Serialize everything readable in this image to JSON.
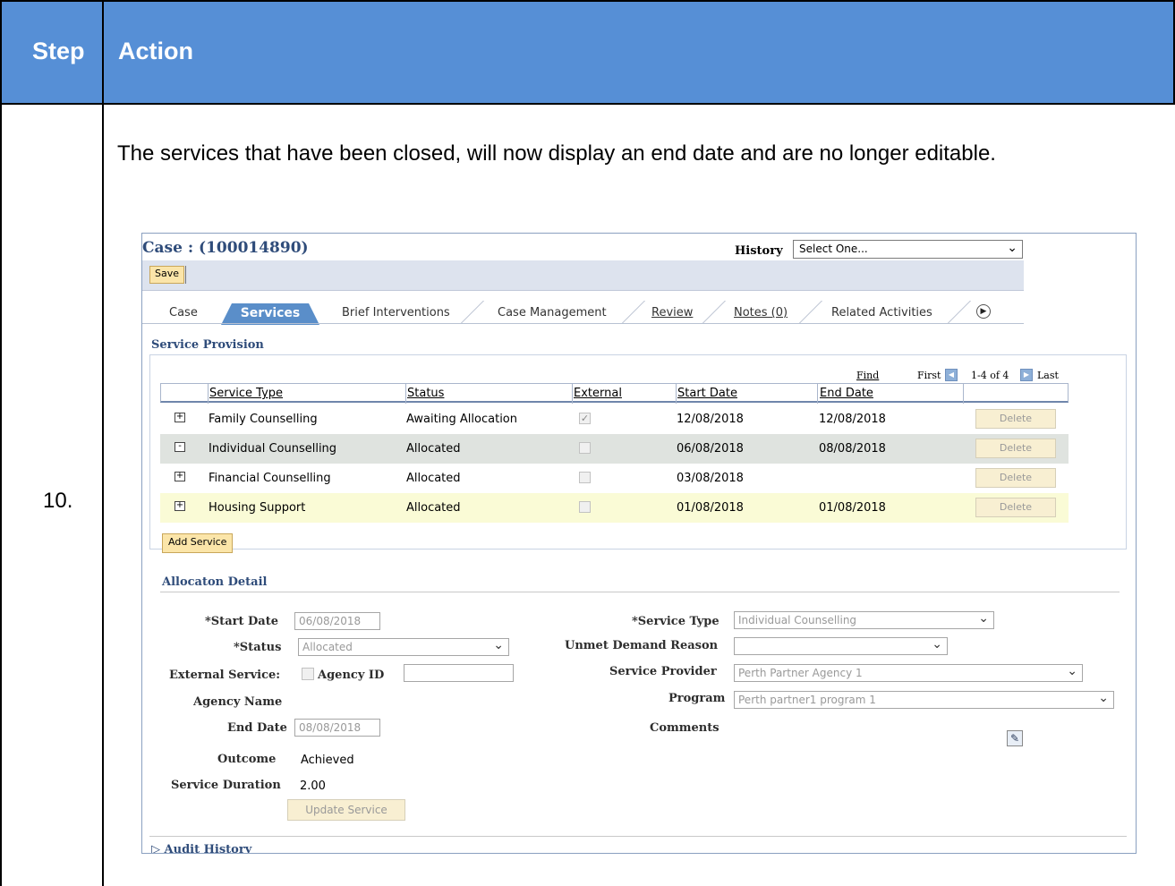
{
  "doc": {
    "header_step": "Step",
    "header_action": "Action",
    "step_number": "10.",
    "description": "The services that have been closed, will now display an end date and are no longer editable."
  },
  "app": {
    "case_title": "Case : (100014890)",
    "history_label": "History",
    "history_value": "Select One...",
    "save_label": "Save",
    "tabs": [
      {
        "label": "Case"
      },
      {
        "label": "Services",
        "active": true
      },
      {
        "label": "Brief Interventions"
      },
      {
        "label": "Case Management"
      },
      {
        "label": "Review"
      },
      {
        "label": "Notes (0)"
      },
      {
        "label": "Related Activities"
      }
    ],
    "service_provision_title": "Service Provision",
    "grid_nav": {
      "find": "Find",
      "first": "First",
      "range": "1-4 of 4",
      "last": "Last"
    },
    "grid": {
      "headers": [
        "Service Type",
        "Status",
        "External",
        "Start Date",
        "End Date"
      ],
      "rows": [
        {
          "service_type": "Family Counselling",
          "status": "Awaiting Allocation",
          "external": true,
          "start_date": "12/08/2018",
          "end_date": "12/08/2018",
          "delete": "Delete",
          "icon": "+"
        },
        {
          "service_type": "Individual Counselling",
          "status": "Allocated",
          "external": false,
          "start_date": "06/08/2018",
          "end_date": "08/08/2018",
          "delete": "Delete",
          "icon": "-"
        },
        {
          "service_type": "Financial Counselling",
          "status": "Allocated",
          "external": false,
          "start_date": "03/08/2018",
          "end_date": "",
          "delete": "Delete",
          "icon": "+"
        },
        {
          "service_type": "Housing Support",
          "status": "Allocated",
          "external": false,
          "start_date": "01/08/2018",
          "end_date": "01/08/2018",
          "delete": "Delete",
          "icon": "+"
        }
      ]
    },
    "add_service_label": "Add Service",
    "allocation_title": "Allocaton Detail",
    "detail": {
      "start_date_label": "*Start Date",
      "start_date_value": "06/08/2018",
      "status_label": "*Status",
      "status_value": "Allocated",
      "external_label": "External Service:",
      "agency_id_label": "Agency ID",
      "agency_id_value": "",
      "agency_name_label": "Agency Name",
      "end_date_label": "End Date",
      "end_date_value": "08/08/2018",
      "outcome_label": "Outcome",
      "outcome_value": "Achieved",
      "duration_label": "Service Duration",
      "duration_value": "2.00",
      "update_label": "Update Service",
      "service_type_label": "*Service Type",
      "service_type_value": "Individual Counselling",
      "unmet_label": "Unmet Demand Reason",
      "unmet_value": "",
      "provider_label": "Service Provider",
      "provider_value": "Perth Partner Agency 1",
      "program_label": "Program",
      "program_value": "Perth partner1 program 1",
      "comments_label": "Comments"
    },
    "audit_label": "Audit History",
    "colors": {
      "header_blue": "#568fd6",
      "tab_active": "#5a8ec9",
      "selected_row": "#dfe3df",
      "highlight_row": "#fafbd6",
      "button_yellow": "#fbe5a9"
    }
  }
}
